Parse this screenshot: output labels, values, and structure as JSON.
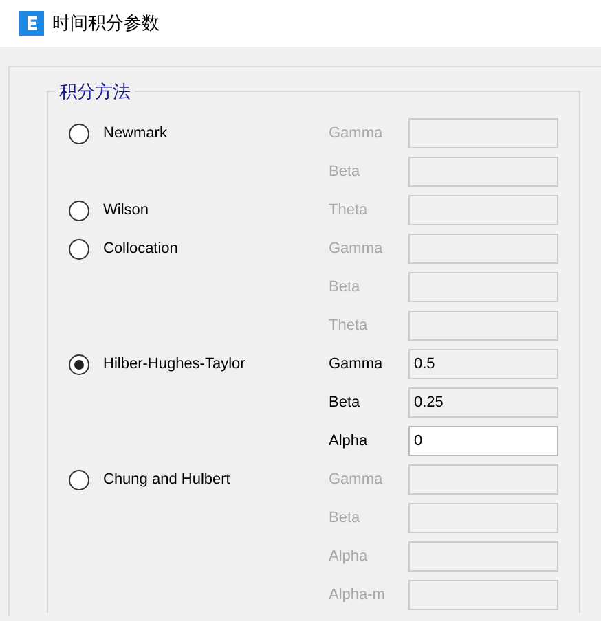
{
  "window": {
    "title": "时间积分参数"
  },
  "group": {
    "title": "积分方法"
  },
  "methods": [
    {
      "name": "Newmark",
      "selected": false,
      "params": [
        {
          "label": "Gamma",
          "disabled": true,
          "readonly": true
        },
        {
          "label": "Beta",
          "disabled": true,
          "readonly": true
        }
      ]
    },
    {
      "name": "Wilson",
      "selected": false,
      "params": [
        {
          "label": "Theta",
          "disabled": true,
          "readonly": true
        }
      ]
    },
    {
      "name": "Collocation",
      "selected": false,
      "params": [
        {
          "label": "Gamma",
          "disabled": true,
          "readonly": true
        },
        {
          "label": "Beta",
          "disabled": true,
          "readonly": true
        },
        {
          "label": "Theta",
          "disabled": true,
          "readonly": true
        }
      ]
    },
    {
      "name": "Hilber-Hughes-Taylor",
      "selected": true,
      "params": [
        {
          "label": "Gamma",
          "value": "0.5",
          "disabled": false,
          "readonly": true
        },
        {
          "label": "Beta",
          "value": "0.25",
          "disabled": false,
          "readonly": true
        },
        {
          "label": "Alpha",
          "value": "0",
          "disabled": false,
          "readonly": false
        }
      ]
    },
    {
      "name": "Chung and Hulbert",
      "selected": false,
      "params": [
        {
          "label": "Gamma",
          "disabled": true,
          "readonly": true
        },
        {
          "label": "Beta",
          "disabled": true,
          "readonly": true
        },
        {
          "label": "Alpha",
          "disabled": true,
          "readonly": true
        },
        {
          "label": "Alpha-m",
          "disabled": true,
          "readonly": true
        }
      ]
    }
  ]
}
